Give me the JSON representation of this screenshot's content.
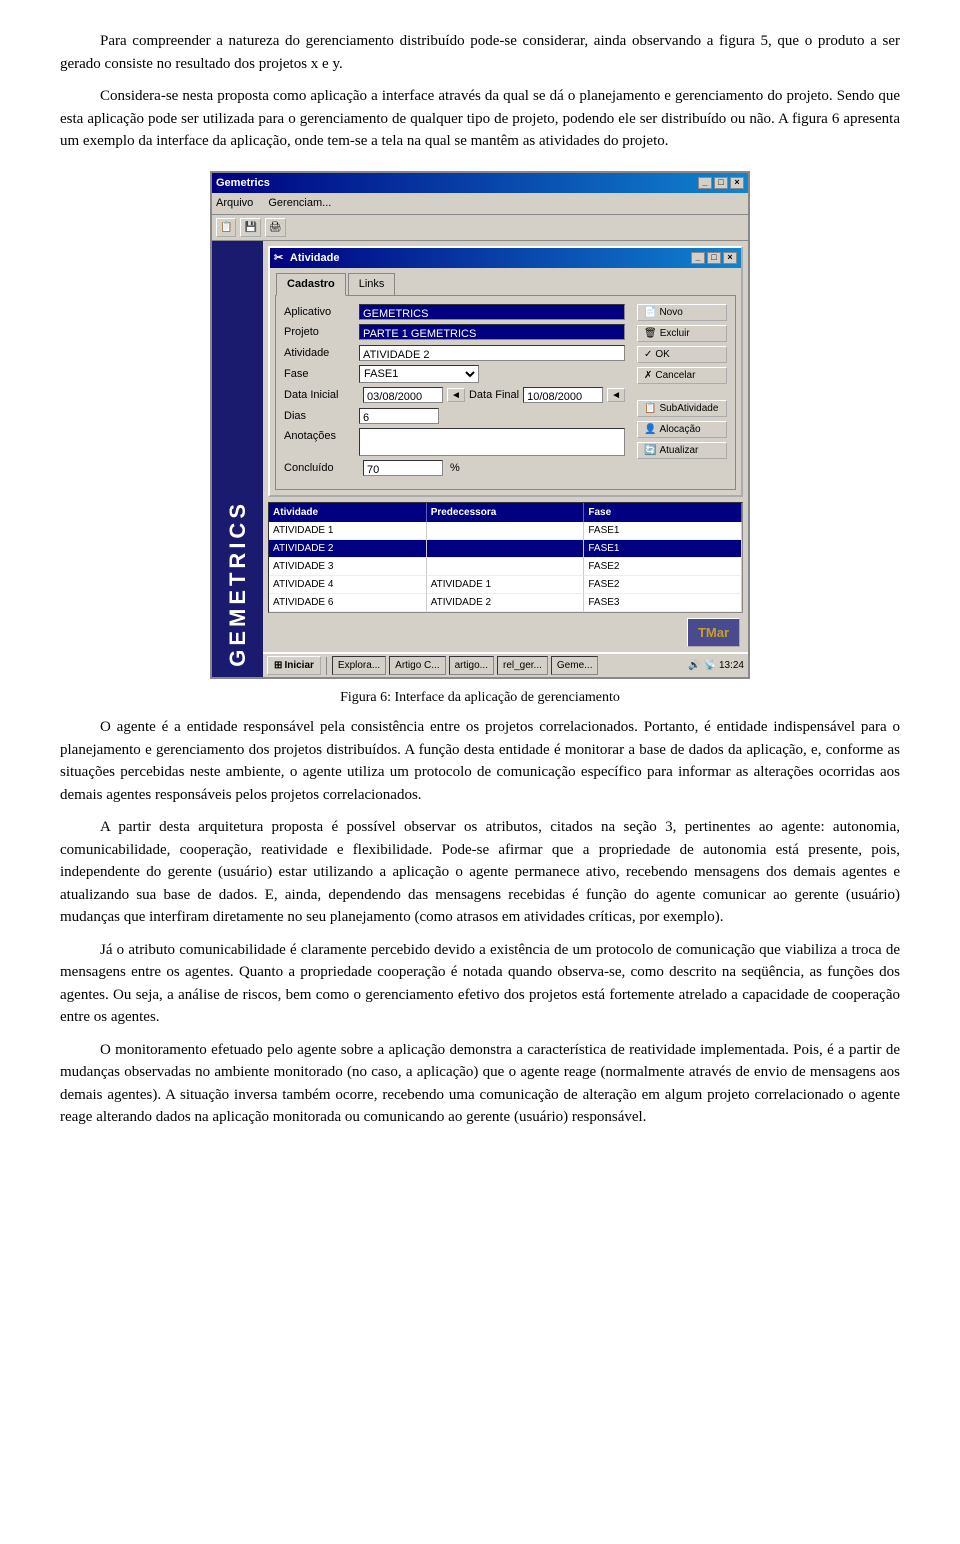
{
  "paragraphs": {
    "p1": "Para compreender a natureza do gerenciamento distribuído pode-se considerar, ainda observando a figura 5, que o produto a ser gerado consiste no resultado dos projetos x e y.",
    "p2": "Considera-se nesta proposta como aplicação a interface através da qual se dá o planejamento e gerenciamento do projeto. Sendo que esta aplicação pode ser utilizada para o gerenciamento de qualquer tipo de projeto, podendo ele ser distribuído ou não. A figura 6 apresenta um exemplo da interface da aplicação, onde tem-se a tela na qual se mantêm as atividades do projeto.",
    "p3": "O agente é a entidade responsável pela consistência entre os projetos correlacionados. Portanto, é entidade indispensável para o planejamento e gerenciamento dos projetos distribuídos. A função desta entidade é monitorar a base de dados da aplicação, e, conforme as situações percebidas neste ambiente, o agente utiliza um protocolo de comunicação específico para informar as alterações ocorridas aos demais agentes responsáveis pelos projetos correlacionados.",
    "p4": "A partir desta arquitetura proposta é possível observar os atributos, citados na seção 3, pertinentes ao agente: autonomia, comunicabilidade, cooperação, reatividade e flexibilidade. Pode-se afirmar que a propriedade de autonomia está presente, pois, independente do gerente (usuário) estar utilizando a aplicação o agente permanece ativo, recebendo mensagens dos demais agentes e atualizando sua base de dados. E, ainda, dependendo das mensagens recebidas é função do agente comunicar ao gerente (usuário) mudanças que interfiram diretamente no seu planejamento (como atrasos em atividades críticas, por exemplo).",
    "p5": "Já o atributo comunicabilidade é claramente percebido devido a existência de um protocolo de comunicação que viabiliza a troca de mensagens entre os agentes. Quanto a propriedade cooperação é notada quando observa-se, como descrito na seqüência, as funções dos agentes. Ou seja, a análise de riscos, bem como o gerenciamento efetivo dos projetos está fortemente atrelado a capacidade de cooperação entre os agentes.",
    "p6": "O monitoramento efetuado pelo agente sobre a aplicação demonstra a característica de reatividade implementada. Pois, é a partir de mudanças observadas no ambiente monitorado (no caso, a aplicação) que o agente reage (normalmente através de envio de mensagens aos demais agentes). A situação inversa também ocorre, recebendo uma comunicação de alteração em algum projeto correlacionado o agente reage alterando dados na aplicação monitorada ou comunicando ao gerente (usuário) responsável."
  },
  "figure": {
    "caption": "Figura 6: Interface da aplicação de gerenciamento",
    "app": {
      "title": "Gemetrics",
      "inner_title": "Atividade",
      "menu_items": [
        "Arquivo",
        "Gerenciam..."
      ],
      "tabs": [
        "Cadastro",
        "Links"
      ],
      "fields": {
        "aplicativo_label": "Aplicativo",
        "aplicativo_value": "GEMETRICS",
        "projeto_label": "Projeto",
        "projeto_value": "PARTE 1 GEMETRICS",
        "atividade_label": "Atividade",
        "atividade_value": "ATIVIDADE 2",
        "fase_label": "Fase",
        "fase_value": "FASE1",
        "data_inicial_label": "Data Inicial",
        "data_inicial_value": "03/08/2000",
        "data_final_label": "Data Final",
        "data_final_value": "10/08/2000",
        "dias_label": "Dias",
        "dias_value": "6",
        "anotacoes_label": "Anotações",
        "concluido_label": "Concluído",
        "concluido_value": "70",
        "percent": "%"
      },
      "buttons": {
        "novo": "Novo",
        "excluir": "Excluir",
        "ok": "OK",
        "cancelar": "Cancelar",
        "subatividade": "SubAtividade",
        "alocacao": "Alocação",
        "atualizar": "Atualizar"
      },
      "table": {
        "headers": [
          "Atividade",
          "Predecessora",
          "Fase"
        ],
        "rows": [
          {
            "atividade": "ATIVIDADE 1",
            "predecessora": "",
            "fase": "FASE1",
            "selected": false
          },
          {
            "atividade": "ATIVIDADE 2",
            "predecessora": "",
            "fase": "FASE1",
            "selected": true
          },
          {
            "atividade": "ATIVIDADE 3",
            "predecessora": "",
            "fase": "FASE2",
            "selected": false
          },
          {
            "atividade": "ATIVIDADE 4",
            "predecessora": "ATIVIDADE 1",
            "fase": "FASE2",
            "selected": false
          },
          {
            "atividade": "ATIVIDADE 6",
            "predecessora": "ATIVIDADE 2",
            "fase": "FASE3",
            "selected": false
          }
        ]
      },
      "taskbar": {
        "start": "Iniciar",
        "items": [
          "Explora...",
          "Artigo C...",
          "artigo...",
          "rel_ger...",
          "Geme..."
        ],
        "time": "13:24"
      },
      "sidebar_text": "GEMETRICS",
      "tmar": "TMar"
    }
  }
}
